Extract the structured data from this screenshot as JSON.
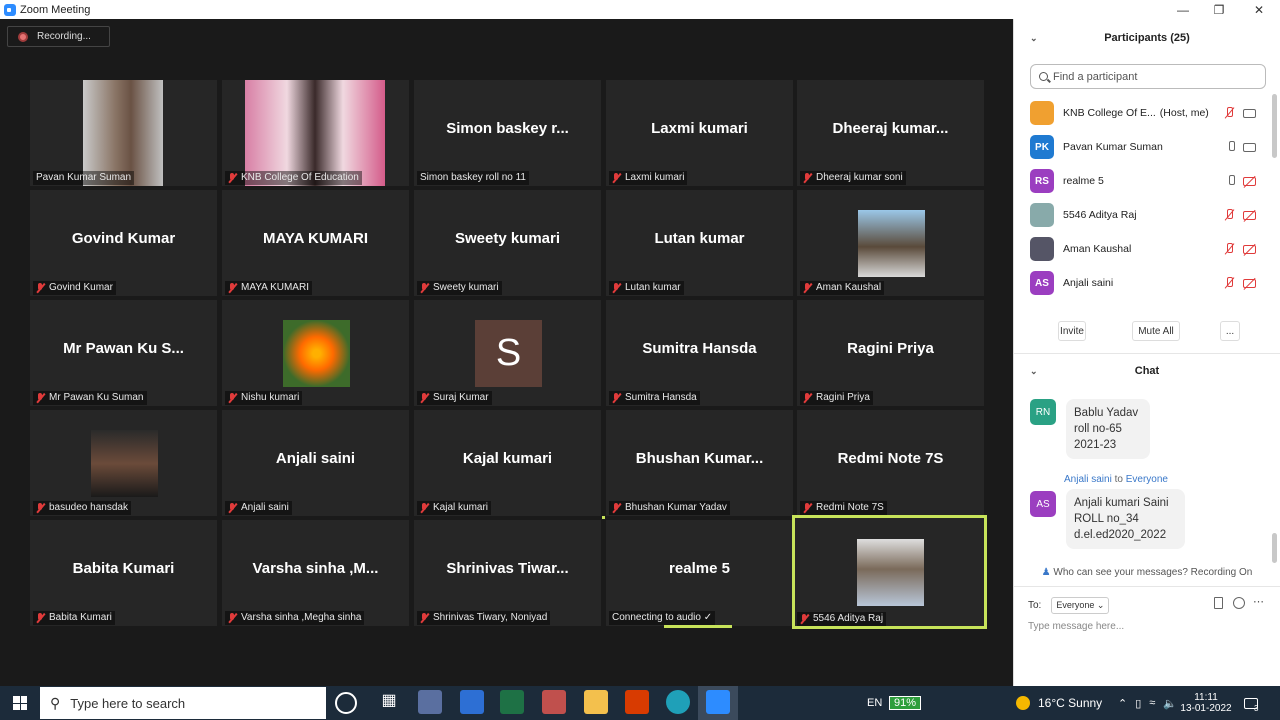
{
  "window": {
    "title": "Zoom Meeting"
  },
  "recording": {
    "label": "Recording..."
  },
  "grid": {
    "tiles": [
      {
        "label": "Pavan Kumar Suman",
        "big": "",
        "muted": false,
        "kind": "video-man"
      },
      {
        "label": "KNB College Of Education",
        "big": "",
        "muted": true,
        "kind": "video-woman"
      },
      {
        "label": "Simon baskey roll no 11",
        "big": "Simon baskey r...",
        "muted": false,
        "kind": "name"
      },
      {
        "label": "Laxmi kumari",
        "big": "Laxmi kumari",
        "muted": true,
        "kind": "name"
      },
      {
        "label": "Dheeraj kumar soni",
        "big": "Dheeraj  kumar...",
        "muted": true,
        "kind": "name"
      },
      {
        "label": "Govind Kumar",
        "big": "Govind Kumar",
        "muted": true,
        "kind": "name"
      },
      {
        "label": "MAYA KUMARI",
        "big": "MAYA KUMARI",
        "muted": true,
        "kind": "name"
      },
      {
        "label": "Sweety kumari",
        "big": "Sweety kumari",
        "muted": true,
        "kind": "name"
      },
      {
        "label": "Lutan kumar",
        "big": "Lutan kumar",
        "muted": true,
        "kind": "name"
      },
      {
        "label": "Aman Kaushal",
        "big": "",
        "muted": true,
        "kind": "pic-boy"
      },
      {
        "label": "Mr  Pawan Ku Suman",
        "big": "Mr  Pawan Ku S...",
        "muted": true,
        "kind": "name"
      },
      {
        "label": "Nishu kumari",
        "big": "",
        "muted": true,
        "kind": "pic-flower"
      },
      {
        "label": "Suraj Kumar",
        "big": "S",
        "muted": true,
        "kind": "letter"
      },
      {
        "label": "Sumitra Hansda",
        "big": "Sumitra Hansda",
        "muted": true,
        "kind": "name"
      },
      {
        "label": "Ragini  Priya",
        "big": "Ragini  Priya",
        "muted": true,
        "kind": "name"
      },
      {
        "label": "basudeo hansdak",
        "big": "",
        "muted": true,
        "kind": "pic-man2"
      },
      {
        "label": "Anjali saini",
        "big": "Anjali saini",
        "muted": true,
        "kind": "name"
      },
      {
        "label": "Kajal kumari",
        "big": "Kajal kumari",
        "muted": true,
        "kind": "name"
      },
      {
        "label": "Bhushan Kumar Yadav",
        "big": "Bhushan  Kumar...",
        "muted": true,
        "kind": "name"
      },
      {
        "label": "Redmi Note 7S",
        "big": "Redmi Note 7S",
        "muted": true,
        "kind": "name"
      },
      {
        "label": "Babita Kumari",
        "big": "Babita Kumari",
        "muted": true,
        "kind": "name"
      },
      {
        "label": "Varsha sinha ,Megha sinha",
        "big": "Varsha  sinha  ,M...",
        "muted": true,
        "kind": "name"
      },
      {
        "label": "Shrinivas Tiwary, Noniyad",
        "big": "Shrinivas  Tiwar...",
        "muted": true,
        "kind": "name"
      },
      {
        "label": "Connecting to audio ✓",
        "big": "realme 5",
        "muted": false,
        "kind": "name"
      },
      {
        "label": "5546 Aditya Raj",
        "big": "",
        "muted": true,
        "kind": "pic-kid"
      }
    ]
  },
  "participants": {
    "header": "Participants (25)",
    "search_placeholder": "Find a participant",
    "list": [
      {
        "name": "KNB College Of E...",
        "suffix": "(Host, me)",
        "initials": "",
        "color": "#f0a030",
        "mic": "red",
        "cam": "gray"
      },
      {
        "name": "Pavan Kumar Suman",
        "suffix": "",
        "initials": "PK",
        "color": "#1f7ad1",
        "mic": "gray",
        "cam": "gray"
      },
      {
        "name": "realme 5",
        "suffix": "",
        "initials": "RS",
        "color": "#9b3ec0",
        "mic": "gray",
        "cam": "red"
      },
      {
        "name": "5546 Aditya Raj",
        "suffix": "",
        "initials": "",
        "color": "#8aa",
        "mic": "red",
        "cam": "red"
      },
      {
        "name": "Aman Kaushal",
        "suffix": "",
        "initials": "",
        "color": "#556",
        "mic": "red",
        "cam": "red"
      },
      {
        "name": "Anjali saini",
        "suffix": "",
        "initials": "AS",
        "color": "#9b3ec0",
        "mic": "red",
        "cam": "red"
      }
    ],
    "invite": "Invite",
    "mute_all": "Mute All",
    "more": "..."
  },
  "chat": {
    "header": "Chat",
    "messages": [
      {
        "initials": "RN",
        "color": "#2aa184",
        "sender": "",
        "lines": [
          "Bablu Yadav",
          "roll no-65",
          "2021-23"
        ]
      },
      {
        "initials": "AS",
        "color": "#9b3ec0",
        "sender": "Anjali saini",
        "to": "to",
        "everyone": "Everyone",
        "lines": [
          "Anjali kumari Saini",
          "ROLL no_34",
          "d.el.ed2020_2022"
        ]
      }
    ],
    "privacy_note": "Who can see your messages? Recording On",
    "to_label": "To:",
    "to_value": "Everyone",
    "placeholder": "Type message here..."
  },
  "taskbar": {
    "search": "Type here to search",
    "lang": "EN",
    "battery": "91%",
    "weather": "16°C  Sunny",
    "time": "11:11",
    "date": "13-01-2022",
    "notif_count": "3"
  }
}
